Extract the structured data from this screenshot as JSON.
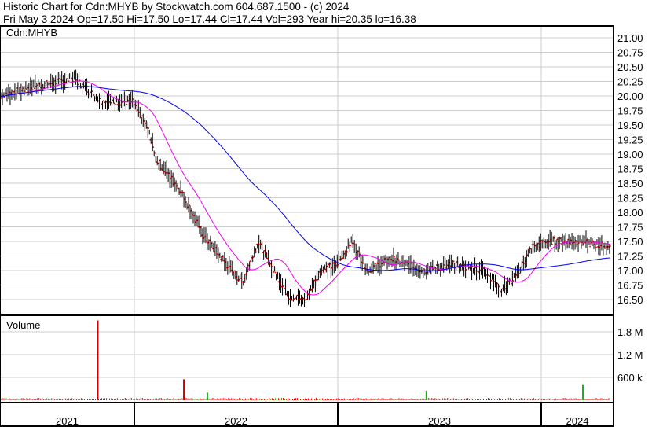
{
  "header": {
    "title": "Historic Chart for Cdn:MHYB by Stockwatch.com 604.687.1500 - (c) 2024",
    "quote": "Fri May  3 2024  Op=17.50  Hi=17.50  Lo=17.44  Cl=17.44  Vol=293  Year hi=20.35  lo=16.38"
  },
  "chart_data": {
    "type": "line",
    "symbol_label": "Cdn:MHYB",
    "volume_label": "Volume",
    "price_ticks": [
      "21.00",
      "20.75",
      "20.50",
      "20.25",
      "20.00",
      "19.75",
      "19.50",
      "19.25",
      "19.00",
      "18.75",
      "18.50",
      "18.25",
      "18.00",
      "17.75",
      "17.50",
      "17.25",
      "17.00",
      "16.75",
      "16.50"
    ],
    "ylim": [
      16.35,
      21.2
    ],
    "volume_ticks": [
      {
        "label": "1.8 M",
        "v": 1800000
      },
      {
        "label": "1.2 M",
        "v": 1200000
      },
      {
        "label": "600 k",
        "v": 600000
      }
    ],
    "years": [
      "2021",
      "2022",
      "2023",
      "2024"
    ],
    "price_keyframes_week_close": [
      [
        0,
        20.0
      ],
      [
        8,
        20.15
      ],
      [
        19,
        20.3
      ],
      [
        26,
        19.9
      ],
      [
        34,
        19.9
      ],
      [
        38,
        19.4
      ],
      [
        40,
        18.9
      ],
      [
        46,
        18.4
      ],
      [
        52,
        17.6
      ],
      [
        58,
        17.1
      ],
      [
        62,
        16.8
      ],
      [
        66,
        17.5
      ],
      [
        70,
        17.0
      ],
      [
        74,
        16.55
      ],
      [
        78,
        16.5
      ],
      [
        82,
        17.0
      ],
      [
        86,
        17.1
      ],
      [
        90,
        17.5
      ],
      [
        94,
        17.0
      ],
      [
        100,
        17.2
      ],
      [
        108,
        17.0
      ],
      [
        116,
        17.1
      ],
      [
        124,
        17.0
      ],
      [
        128,
        16.65
      ],
      [
        132,
        16.9
      ],
      [
        136,
        17.4
      ],
      [
        140,
        17.5
      ],
      [
        148,
        17.5
      ],
      [
        156,
        17.4
      ]
    ],
    "volume_spikes_week": [
      [
        25,
        2100000,
        "#cc0000"
      ],
      [
        47,
        550000,
        "#cc0000"
      ],
      [
        53,
        200000,
        "#22aa22"
      ],
      [
        109,
        250000,
        "#22aa22"
      ],
      [
        149,
        420000,
        "#22aa22"
      ]
    ],
    "series": [
      {
        "name": "price",
        "color": "#000000"
      },
      {
        "name": "MA short",
        "color": "#ee00ee"
      },
      {
        "name": "MA long",
        "color": "#0000ee"
      }
    ]
  }
}
